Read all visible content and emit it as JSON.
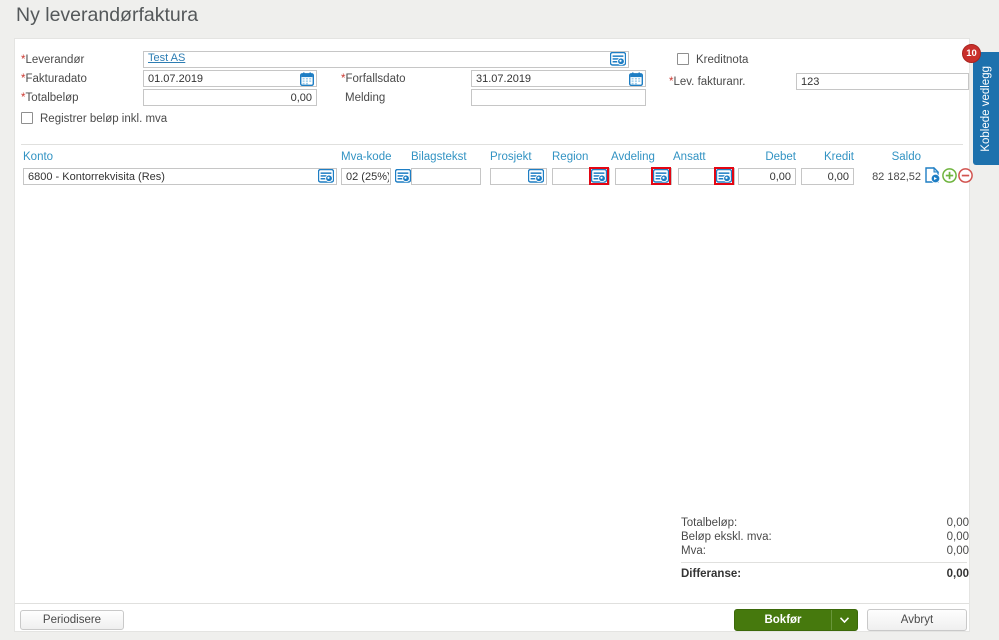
{
  "title": "Ny leverandørfaktura",
  "required_marker": "*",
  "form": {
    "leverandor": {
      "label": "Leverandør",
      "value": "Test AS"
    },
    "fakturadato": {
      "label": "Fakturadato",
      "value": "01.07.2019"
    },
    "forfallsdato": {
      "label": "Forfallsdato",
      "value": "31.07.2019"
    },
    "totalbelop": {
      "label": "Totalbeløp",
      "value": "0,00"
    },
    "melding": {
      "label": "Melding",
      "value": ""
    },
    "kreditnota": {
      "label": "Kreditnota",
      "checked": false
    },
    "lev_fakturanr": {
      "label": "Lev. fakturanr.",
      "value": "123"
    },
    "registrer_inkl_mva": {
      "label": "Registrer beløp inkl. mva",
      "checked": false
    }
  },
  "table": {
    "headers": {
      "konto": "Konto",
      "mva": "Mva-kode",
      "bilagstekst": "Bilagstekst",
      "prosjekt": "Prosjekt",
      "region": "Region",
      "avdeling": "Avdeling",
      "ansatt": "Ansatt",
      "debet": "Debet",
      "kredit": "Kredit",
      "saldo": "Saldo"
    },
    "row": {
      "konto": "6800 - Kontorrekvisita (Res)",
      "mva": "02 (25%)",
      "bilagstekst": "",
      "prosjekt": "",
      "region": "",
      "avdeling": "",
      "ansatt": "",
      "debet": "0,00",
      "kredit": "0,00",
      "saldo": "82 182,52"
    }
  },
  "attachments_tab": {
    "label": "Koblede vedlegg",
    "badge": "10"
  },
  "summary": {
    "rows": [
      {
        "label": "Totalbeløp:",
        "value": "0,00"
      },
      {
        "label": "Beløp ekskl. mva:",
        "value": "0,00"
      },
      {
        "label": "Mva:",
        "value": "0,00"
      }
    ],
    "difference": {
      "label": "Differanse:",
      "value": "0,00"
    }
  },
  "footer": {
    "periodisere": "Periodisere",
    "bokfor": "Bokfør",
    "avbryt": "Avbryt"
  },
  "colors": {
    "accent_blue": "#3293c3",
    "icon_blue": "#1e7ec4",
    "tab_blue": "#1d71ad",
    "badge_red": "#c9302c",
    "button_green": "#46790d",
    "link_blue": "#2d7db3",
    "plus_green": "#6fb43f",
    "minus_red": "#d25450",
    "highlight_red": "#e30613"
  }
}
